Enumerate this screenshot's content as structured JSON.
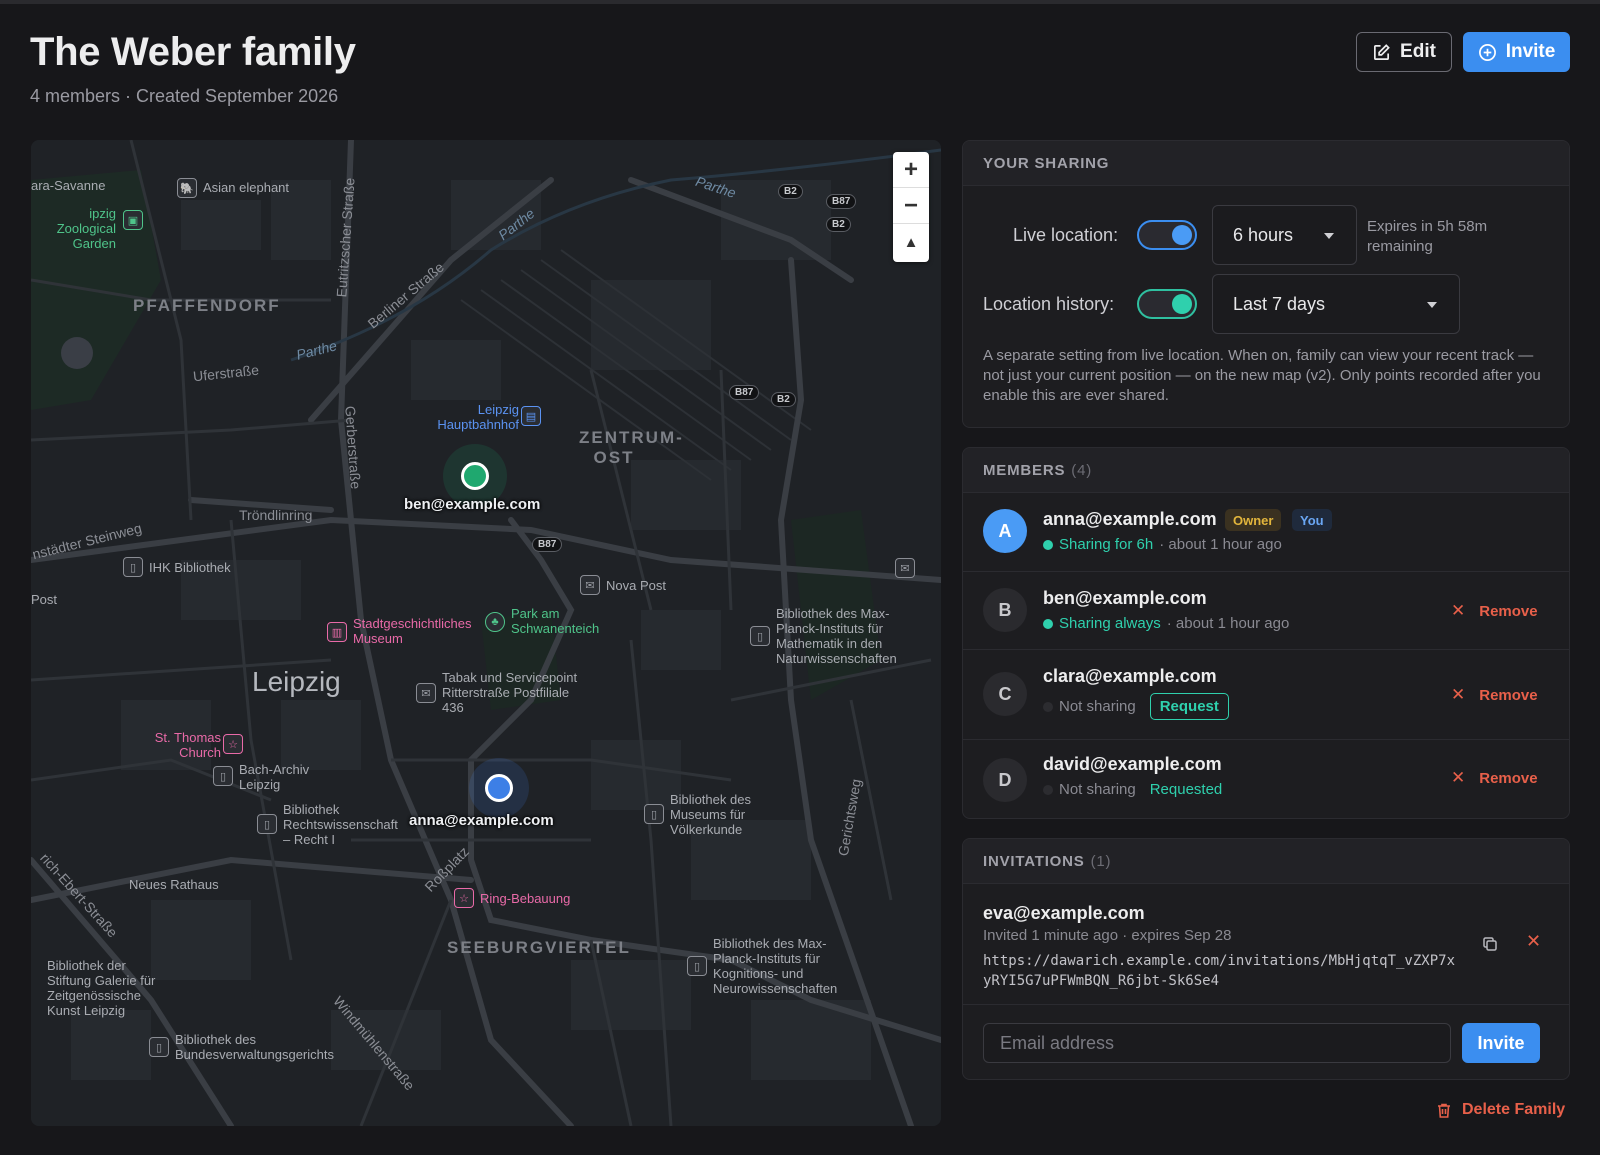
{
  "header": {
    "title": "The Weber family",
    "subtitle": "4 members · Created September 2026",
    "edit_label": "Edit",
    "invite_label": "Invite"
  },
  "map": {
    "labels": {
      "asian_elephant": "Asian elephant",
      "ara_savanne": "ara-Savanne",
      "zoo": "ipzig Zoological Garden",
      "pfaffendorf": "PFAFFENDORF",
      "uferstrasse": "Uferstraße",
      "parthe1": "Parthe",
      "parthe2": "Parthe",
      "parthe3": "Parthe",
      "berliner": "Berliner Straße",
      "eutritzscher": "Eutritzscher Straße",
      "gerberstrasse": "Gerberstraße",
      "hauptbahnhof": "Leipzig Hauptbahnhof",
      "zentrum_ost": "ZENTRUM-OST",
      "troendlinring": "Tröndlinring",
      "steinweg": "nstädter Steinweg",
      "ihk": "IHK Bibliothek",
      "post": "Post",
      "nova_post": "Nova Post",
      "park": "Park am Schwanenteich",
      "stadtmuseum": "Stadtgeschichtliches Museum",
      "bib_max_math": "Bibliothek des Max-Planck-Instituts für Mathematik in den Naturwissenschaften",
      "leipzig": "Leipzig",
      "tabak": "Tabak und Servicepoint Ritterstraße Postfiliale 436",
      "thomas": "St. Thomas Church",
      "bach": "Bach-Archiv Leipzig",
      "bib_recht": "Bibliothek Rechtswissenschaft – Recht I",
      "bib_voelker": "Bibliothek des Museums für Völkerkunde",
      "rathaus": "Neues Rathaus",
      "rossplatz": "Roßplatz",
      "ring": "Ring-Bebauung",
      "seeburg": "SEEBURGVIERTEL",
      "bib_kogn": "Bibliothek des Max-Planck-Instituts für Kognitions- und Neurowissenschaften",
      "bib_stiftung": "Bibliothek der Stiftung Galerie für Zeitgenössische Kunst Leipzig",
      "ebert": "rich-Ebert-Straße",
      "bib_bverwg": "Bibliothek des Bundesverwaltungsgerichts",
      "windmuehlen": "Windmühlenstraße",
      "gerichtsweg": "Gerichtsweg"
    },
    "roads": {
      "b2": "B2",
      "b87": "B87"
    },
    "zoom_in": "+",
    "zoom_out": "−",
    "compass": "▲",
    "markers": {
      "ben": "ben@example.com",
      "anna": "anna@example.com"
    },
    "colors": {
      "ben": "#1fa86f",
      "anna": "#3d7fe6"
    }
  },
  "sharing": {
    "heading": "YOUR SHARING",
    "live_label": "Live location:",
    "live_duration": "6 hours",
    "live_expires": "Expires in 5h 58m remaining",
    "history_label": "Location history:",
    "history_range": "Last 7 days",
    "description": "A separate setting from live location. When on, family can view your recent track — not just your current position — on the new map (v2). Only points recorded after you enable this are ever shared."
  },
  "members": {
    "heading": "MEMBERS",
    "count": "(4)",
    "remove_label": "Remove",
    "list": [
      {
        "initial": "A",
        "email": "anna@example.com",
        "owner": "Owner",
        "you": "You",
        "status": "Sharing for 6h",
        "time": "· about 1 hour ago"
      },
      {
        "initial": "B",
        "email": "ben@example.com",
        "status": "Sharing always",
        "time": "· about 1 hour ago"
      },
      {
        "initial": "C",
        "email": "clara@example.com",
        "status": "Not sharing",
        "action": "Request"
      },
      {
        "initial": "D",
        "email": "david@example.com",
        "status": "Not sharing",
        "action": "Requested"
      }
    ]
  },
  "invitations": {
    "heading": "INVITATIONS",
    "count": "(1)",
    "email": "eva@example.com",
    "meta": "Invited 1 minute ago · expires Sep 28",
    "url": "https://dawarich.example.com/invitations/MbHjqtqT_vZXP7xyRYI5G7uPFWmBQN_R6jbt-Sk6Se4",
    "placeholder": "Email address",
    "submit": "Invite"
  },
  "delete_label": "Delete Family",
  "colors": {
    "accent": "#3b8ef0",
    "teal": "#2fd0ad",
    "danger": "#e8604a"
  }
}
